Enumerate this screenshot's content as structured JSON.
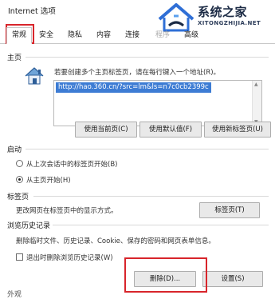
{
  "window": {
    "title": "Internet 选项"
  },
  "watermark": {
    "brand": "系统之家",
    "domain": "XITONGZHIJIA.NET"
  },
  "tabs": [
    {
      "label": "常规",
      "active": true
    },
    {
      "label": "安全"
    },
    {
      "label": "隐私"
    },
    {
      "label": "内容"
    },
    {
      "label": "连接"
    },
    {
      "label": "程序"
    },
    {
      "label": "高级"
    }
  ],
  "home": {
    "section": "主页",
    "desc": "若要创建多个主页标签页，请在每行键入一个地址(R)。",
    "url": "http://hao.360.cn/?src=lm&ls=n7c0cb2399c",
    "buttons": {
      "current": "使用当前页(C)",
      "default": "使用默认值(F)",
      "newtab": "使用新标签页(U)"
    }
  },
  "startup": {
    "section": "启动",
    "options": [
      {
        "label": "从上次会话中的标签页开始(B)",
        "checked": false
      },
      {
        "label": "从主页开始(H)",
        "checked": true
      }
    ]
  },
  "tabs_section": {
    "section": "标签页",
    "desc": "更改网页在标签页中的显示方式。",
    "button": "标签页(T)"
  },
  "history": {
    "section": "浏览历史记录",
    "desc": "删除临时文件、历史记录、Cookie、保存的密码和网页表单信息。",
    "checkbox": "退出时删除浏览历史记录(W)",
    "delete_button": "删除(D)...",
    "settings_button": "设置(S)",
    "next_section": "外观"
  },
  "colors": {
    "highlight": "#d8252b",
    "selection": "#3d7cd4"
  }
}
